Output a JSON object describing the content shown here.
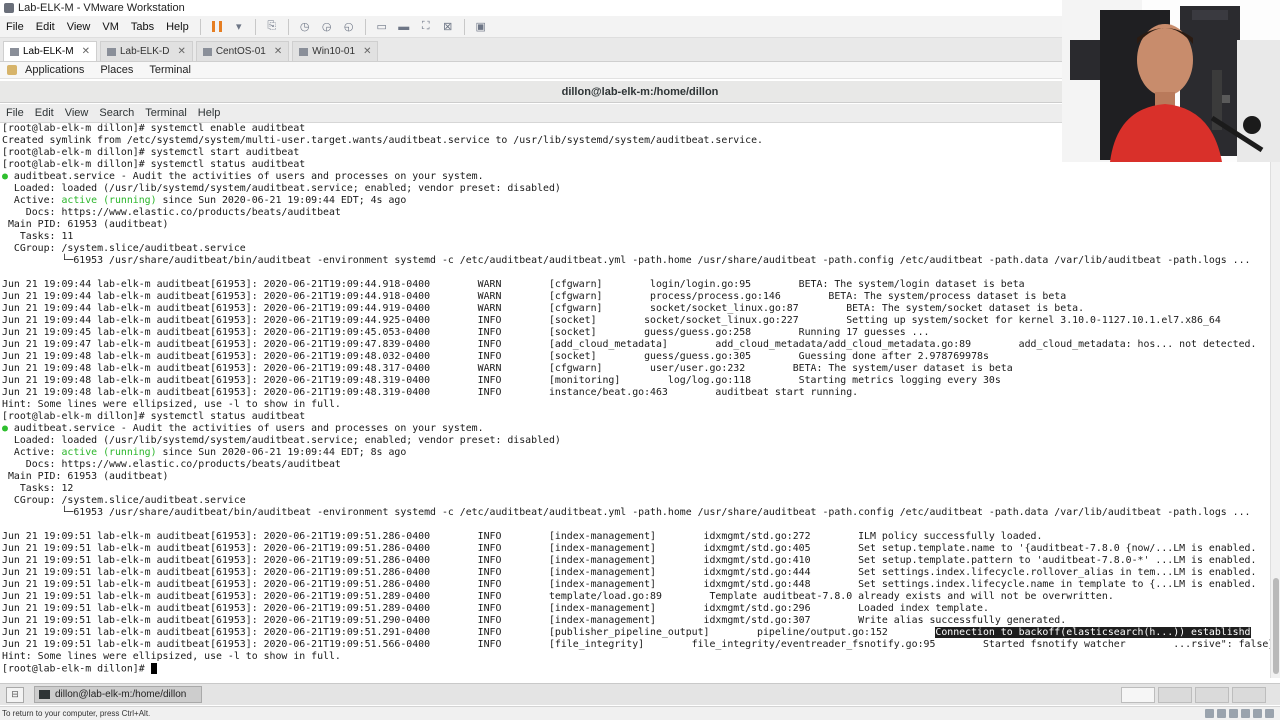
{
  "window": {
    "title": "Lab-ELK-M - VMware Workstation"
  },
  "vm_menu": [
    "File",
    "Edit",
    "View",
    "VM",
    "Tabs",
    "Help"
  ],
  "vm_tabs": [
    {
      "label": "Lab-ELK-M",
      "active": true
    },
    {
      "label": "Lab-ELK-D",
      "active": false
    },
    {
      "label": "CentOS-01",
      "active": false
    },
    {
      "label": "Win10-01",
      "active": false
    }
  ],
  "gnome_panel": {
    "applications": "Applications",
    "places": "Places",
    "terminal": "Terminal"
  },
  "terminal": {
    "title": "dillon@lab-elk-m:/home/dillon",
    "menu": [
      "File",
      "Edit",
      "View",
      "Search",
      "Terminal",
      "Help"
    ],
    "status1": {
      "dot": "●",
      "unit_line": " auditbeat.service - Audit the activities of users and processes on your system.",
      "loaded": "  Loaded: loaded (/usr/lib/systemd/system/auditbeat.service; enabled; vendor preset: disabled)",
      "active_label": "  Active: ",
      "active_state": "active (running)",
      "active_rest": " since Sun 2020-06-21 19:09:44 EDT; 4s ago",
      "docs": "    Docs: https://www.elastic.co/products/beats/auditbeat",
      "pid": " Main PID: 61953 (auditbeat)",
      "tasks": "   Tasks: 11",
      "cgroup": "  CGroup: /system.slice/auditbeat.service",
      "cgroup_child": "          └─61953 /usr/share/auditbeat/bin/auditbeat -environment systemd -c /etc/auditbeat/auditbeat.yml -path.home /usr/share/auditbeat -path.config /etc/auditbeat -path.data /var/lib/auditbeat -path.logs ..."
    },
    "status2": {
      "dot": "●",
      "unit_line": " auditbeat.service - Audit the activities of users and processes on your system.",
      "loaded": "  Loaded: loaded (/usr/lib/systemd/system/auditbeat.service; enabled; vendor preset: disabled)",
      "active_label": "  Active: ",
      "active_state": "active (running)",
      "active_rest": " since Sun 2020-06-21 19:09:44 EDT; 8s ago",
      "docs": "    Docs: https://www.elastic.co/products/beats/auditbeat",
      "pid": " Main PID: 61953 (auditbeat)",
      "tasks": "   Tasks: 12",
      "cgroup": "  CGroup: /system.slice/auditbeat.service",
      "cgroup_child": "          └─61953 /usr/share/auditbeat/bin/auditbeat -environment systemd -c /etc/auditbeat/auditbeat.yml -path.home /usr/share/auditbeat -path.config /etc/auditbeat -path.data /var/lib/auditbeat -path.logs ..."
    },
    "lines_top": [
      "[root@lab-elk-m dillon]# systemctl enable auditbeat",
      "Created symlink from /etc/systemd/system/multi-user.target.wants/auditbeat.service to /usr/lib/systemd/system/auditbeat.service.",
      "[root@lab-elk-m dillon]# systemctl start auditbeat",
      "[root@lab-elk-m dillon]# systemctl status auditbeat"
    ],
    "log1": [
      "Jun 21 19:09:44 lab-elk-m auditbeat[61953]: 2020-06-21T19:09:44.918-0400        WARN        [cfgwarn]        login/login.go:95        BETA: The system/login dataset is beta",
      "Jun 21 19:09:44 lab-elk-m auditbeat[61953]: 2020-06-21T19:09:44.918-0400        WARN        [cfgwarn]        process/process.go:146        BETA: The system/process dataset is beta",
      "Jun 21 19:09:44 lab-elk-m auditbeat[61953]: 2020-06-21T19:09:44.919-0400        WARN        [cfgwarn]        socket/socket_linux.go:87        BETA: The system/socket dataset is beta.",
      "Jun 21 19:09:44 lab-elk-m auditbeat[61953]: 2020-06-21T19:09:44.925-0400        INFO        [socket]        socket/socket_linux.go:227        Setting up system/socket for kernel 3.10.0-1127.10.1.el7.x86_64",
      "Jun 21 19:09:45 lab-elk-m auditbeat[61953]: 2020-06-21T19:09:45.053-0400        INFO        [socket]        guess/guess.go:258        Running 17 guesses ...",
      "Jun 21 19:09:47 lab-elk-m auditbeat[61953]: 2020-06-21T19:09:47.839-0400        INFO        [add_cloud_metadata]        add_cloud_metadata/add_cloud_metadata.go:89        add_cloud_metadata: hos... not detected.",
      "Jun 21 19:09:48 lab-elk-m auditbeat[61953]: 2020-06-21T19:09:48.032-0400        INFO        [socket]        guess/guess.go:305        Guessing done after 2.978769978s",
      "Jun 21 19:09:48 lab-elk-m auditbeat[61953]: 2020-06-21T19:09:48.317-0400        WARN        [cfgwarn]        user/user.go:232        BETA: The system/user dataset is beta",
      "Jun 21 19:09:48 lab-elk-m auditbeat[61953]: 2020-06-21T19:09:48.319-0400        INFO        [monitoring]        log/log.go:118        Starting metrics logging every 30s",
      "Jun 21 19:09:48 lab-elk-m auditbeat[61953]: 2020-06-21T19:09:48.319-0400        INFO        instance/beat.go:463        auditbeat start running."
    ],
    "hint1": "Hint: Some lines were ellipsized, use -l to show in full.",
    "cmd2": "[root@lab-elk-m dillon]# systemctl status auditbeat",
    "log2": [
      "Jun 21 19:09:51 lab-elk-m auditbeat[61953]: 2020-06-21T19:09:51.286-0400        INFO        [index-management]        idxmgmt/std.go:272        ILM policy successfully loaded.",
      "Jun 21 19:09:51 lab-elk-m auditbeat[61953]: 2020-06-21T19:09:51.286-0400        INFO        [index-management]        idxmgmt/std.go:405        Set setup.template.name to '{auditbeat-7.8.0 {now/...LM is enabled.",
      "Jun 21 19:09:51 lab-elk-m auditbeat[61953]: 2020-06-21T19:09:51.286-0400        INFO        [index-management]        idxmgmt/std.go:410        Set setup.template.pattern to 'auditbeat-7.8.0-*' ...LM is enabled.",
      "Jun 21 19:09:51 lab-elk-m auditbeat[61953]: 2020-06-21T19:09:51.286-0400        INFO        [index-management]        idxmgmt/std.go:444        Set settings.index.lifecycle.rollover_alias in tem...LM is enabled.",
      "Jun 21 19:09:51 lab-elk-m auditbeat[61953]: 2020-06-21T19:09:51.286-0400        INFO        [index-management]        idxmgmt/std.go:448        Set settings.index.lifecycle.name in template to {...LM is enabled.",
      "Jun 21 19:09:51 lab-elk-m auditbeat[61953]: 2020-06-21T19:09:51.289-0400        INFO        template/load.go:89        Template auditbeat-7.8.0 already exists and will not be overwritten.",
      "Jun 21 19:09:51 lab-elk-m auditbeat[61953]: 2020-06-21T19:09:51.289-0400        INFO        [index-management]        idxmgmt/std.go:296        Loaded index template.",
      "Jun 21 19:09:51 lab-elk-m auditbeat[61953]: 2020-06-21T19:09:51.290-0400        INFO        [index-management]        idxmgmt/std.go:307        Write alias successfully generated."
    ],
    "log2_hl": {
      "prefix": "Jun 21 19:09:51 lab-elk-m auditbeat[61953]: 2020-06-21T19:09:51.291-0400        INFO        [publisher_pipeline_output]        pipeline/output.go:152        ",
      "highlight": "Connection to backoff(elasticsearch(h...)) establishd"
    },
    "log2_last": "Jun 21 19:09:51 lab-elk-m auditbeat[61953]: 2020-06-21T19:09:51.566-0400        INFO        [file_integrity]        file_integrity/eventreader_fsnotify.go:95        Started fsnotify watcher        ...rsive\": false}",
    "hint2": "Hint: Some lines were ellipsized, use -l to show in full.",
    "prompt": "[root@lab-elk-m dillon]# "
  },
  "taskbar": {
    "item": "dillon@lab-elk-m:/home/dillon"
  },
  "statusbar": {
    "text": "To return to your computer, press Ctrl+Alt."
  },
  "colors": {
    "active_running": "#2bb52b",
    "highlight_bg": "#1e1e1e"
  }
}
